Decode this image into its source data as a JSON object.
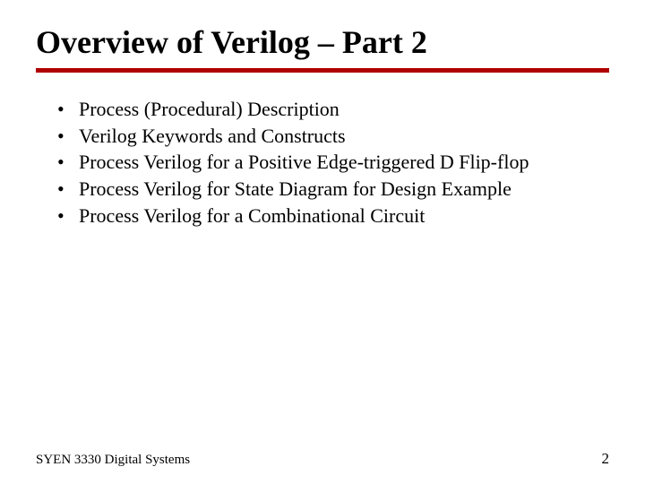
{
  "title": "Overview of Verilog – Part 2",
  "bullets": [
    "Process (Procedural) Description",
    "Verilog Keywords and Constructs",
    "Process Verilog for a Positive Edge-triggered D Flip-flop",
    "Process Verilog for State Diagram for Design Example",
    "Process Verilog for a Combinational Circuit"
  ],
  "footer": {
    "course": "SYEN 3330 Digital Systems",
    "page": "2"
  }
}
